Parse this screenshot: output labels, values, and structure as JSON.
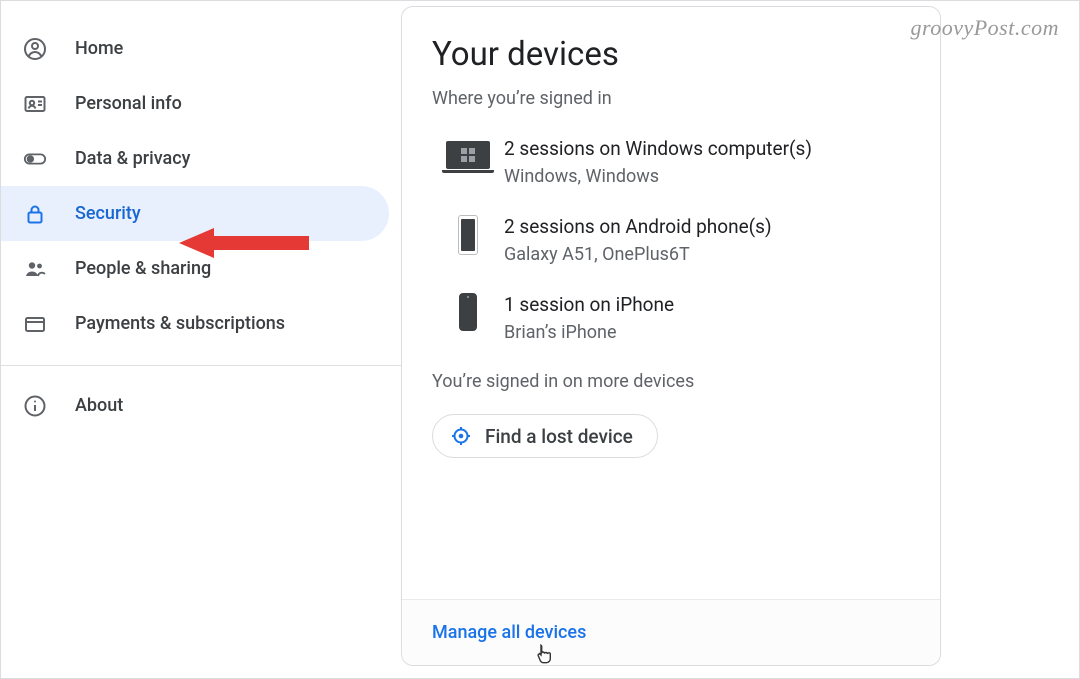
{
  "watermark": "groovyPost.com",
  "sidebar": {
    "items": [
      {
        "label": "Home"
      },
      {
        "label": "Personal info"
      },
      {
        "label": "Data & privacy"
      },
      {
        "label": "Security"
      },
      {
        "label": "People & sharing"
      },
      {
        "label": "Payments & subscriptions"
      },
      {
        "label": "About"
      }
    ]
  },
  "card": {
    "title": "Your devices",
    "subtitle": "Where you’re signed in",
    "devices": [
      {
        "primary": "2 sessions on Windows computer(s)",
        "secondary": "Windows, Windows"
      },
      {
        "primary": "2 sessions on Android phone(s)",
        "secondary": "Galaxy A51, OnePlus6T"
      },
      {
        "primary": "1 session on iPhone",
        "secondary": "Brian’s iPhone"
      }
    ],
    "more_note": "You’re signed in on more devices",
    "find_label": "Find a lost device",
    "manage_label": "Manage all devices"
  }
}
